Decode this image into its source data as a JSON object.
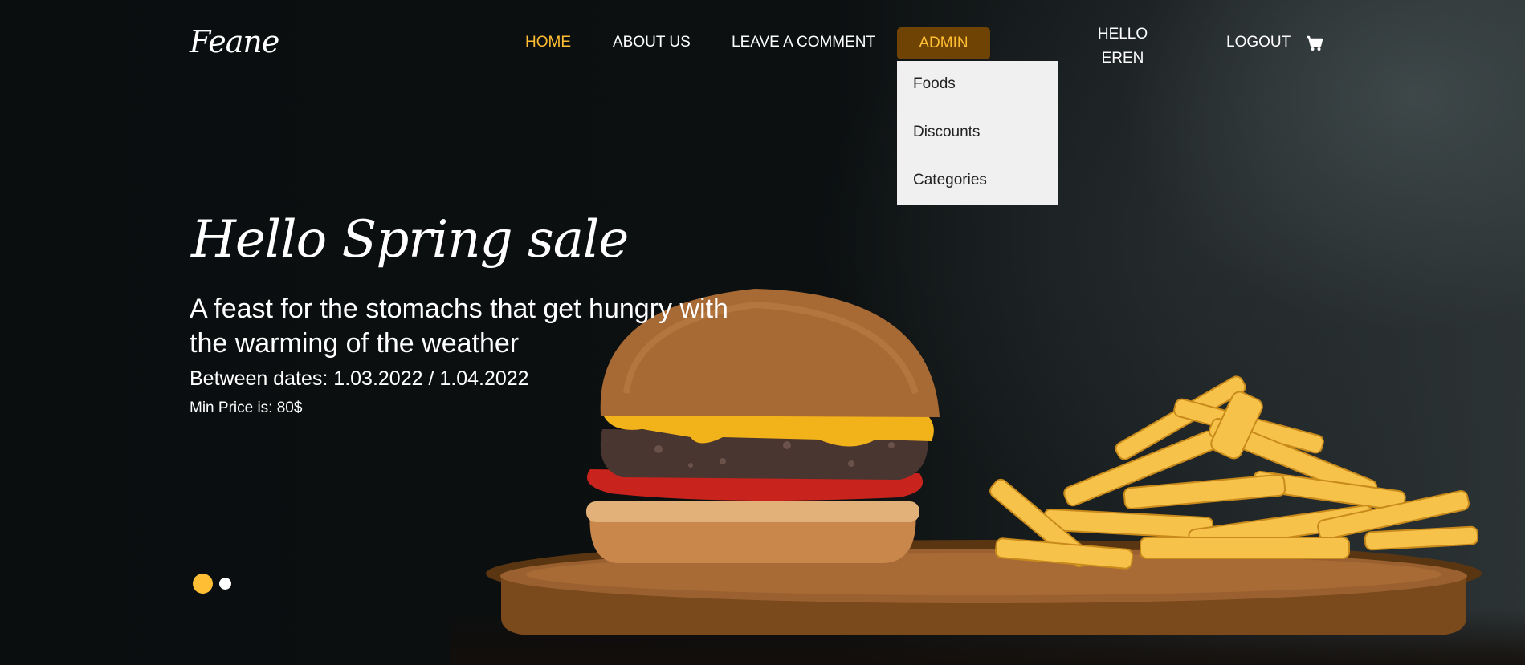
{
  "brand": {
    "logo_text": "Feane"
  },
  "nav": {
    "items": [
      {
        "label": "HOME"
      },
      {
        "label": "ABOUT US"
      },
      {
        "label": "LEAVE A COMMENT"
      }
    ],
    "admin_label": "ADMIN",
    "admin_menu": [
      {
        "label": "Foods"
      },
      {
        "label": "Discounts"
      },
      {
        "label": "Categories"
      }
    ],
    "greeting": "HELLO EREN",
    "logout_label": "LOGOUT",
    "cart_icon": "cart-icon"
  },
  "hero": {
    "title": "Hello Spring sale",
    "subtitle": "A feast for the stomachs that get hungry with the warming of the weather",
    "dates": "Between dates: 1.03.2022 / 1.04.2022",
    "min_price": "Min Price is: 80$"
  },
  "colors": {
    "accent": "#ffbe33",
    "admin_bg": "#6f4303",
    "dropdown_bg": "#f0f0f0",
    "background": "#0c0f10"
  }
}
